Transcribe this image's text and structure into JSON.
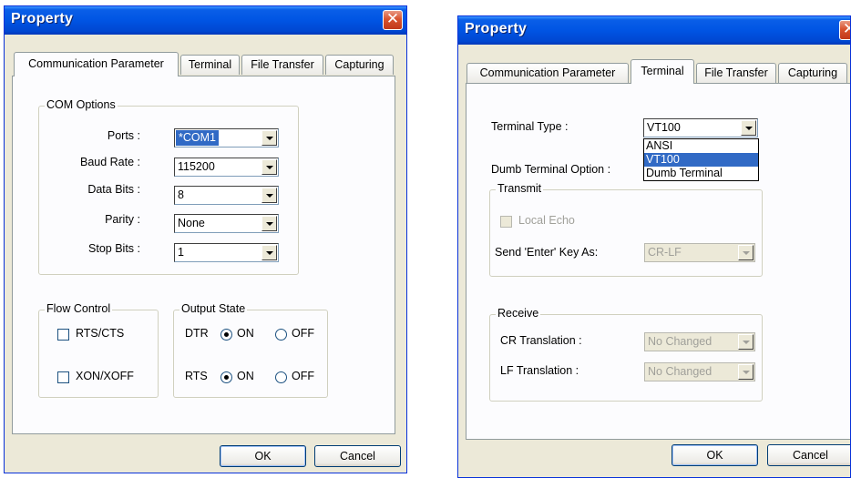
{
  "left_dialog": {
    "title": "Property",
    "close_glyph": "✕",
    "tabs": [
      "Communication Parameter",
      "Terminal",
      "File Transfer",
      "Capturing"
    ],
    "active_tab": "Communication Parameter",
    "com_options": {
      "title": "COM Options",
      "ports": {
        "label": "Ports :",
        "value": "*COM1"
      },
      "baud_rate": {
        "label": "Baud Rate :",
        "value": "115200"
      },
      "data_bits": {
        "label": "Data Bits :",
        "value": "8"
      },
      "parity": {
        "label": "Parity :",
        "value": "None"
      },
      "stop_bits": {
        "label": "Stop Bits :",
        "value": "1"
      }
    },
    "flow_control": {
      "title": "Flow Control",
      "rts_cts": {
        "label": "RTS/CTS",
        "checked": false
      },
      "xon_xoff": {
        "label": "XON/XOFF",
        "checked": false
      }
    },
    "output_state": {
      "title": "Output State",
      "dtr": {
        "label": "DTR",
        "on_label": "ON",
        "off_label": "OFF",
        "selected": "ON"
      },
      "rts": {
        "label": "RTS",
        "on_label": "ON",
        "off_label": "OFF",
        "selected": "ON"
      }
    },
    "ok_label": "OK",
    "cancel_label": "Cancel"
  },
  "right_dialog": {
    "title": "Property",
    "tabs": [
      "Communication Parameter",
      "Terminal",
      "File Transfer",
      "Capturing"
    ],
    "active_tab": "Terminal",
    "terminal_type": {
      "label": "Terminal Type :",
      "value": "VT100",
      "options": [
        "ANSI",
        "VT100",
        "Dumb Terminal"
      ],
      "highlighted": "VT100"
    },
    "dumb_terminal_option_label": "Dumb Terminal Option :",
    "transmit": {
      "title": "Transmit",
      "local_echo": {
        "label": "Local Echo",
        "checked": false,
        "enabled": false
      },
      "send_enter": {
        "label": "Send 'Enter' Key As:",
        "value": "CR-LF",
        "enabled": false
      }
    },
    "receive": {
      "title": "Receive",
      "cr_translation": {
        "label": "CR Translation :",
        "value": "No Changed",
        "enabled": false
      },
      "lf_translation": {
        "label": "LF Translation :",
        "value": "No Changed",
        "enabled": false
      }
    },
    "ok_label": "OK",
    "cancel_label": "Cancel"
  }
}
